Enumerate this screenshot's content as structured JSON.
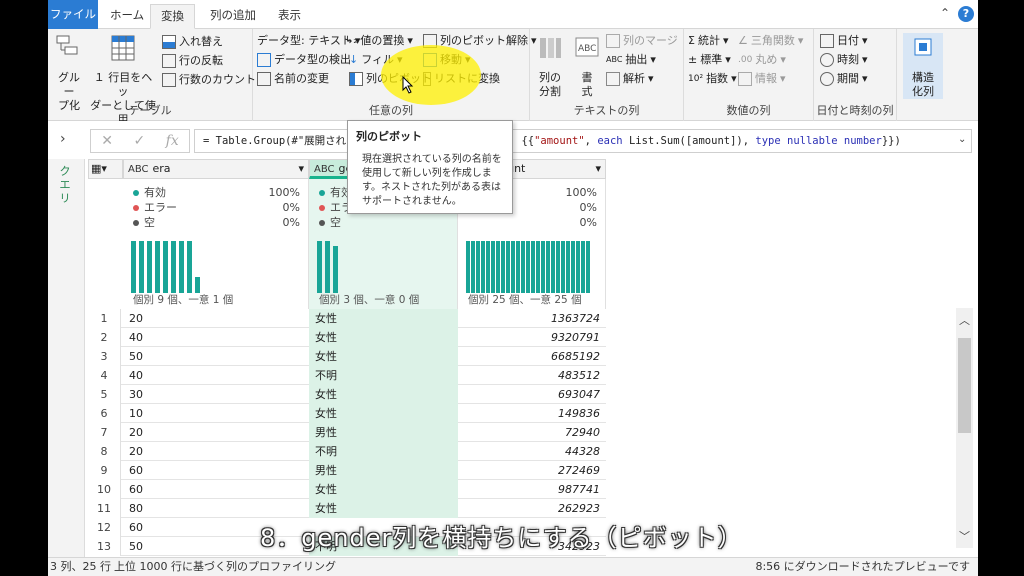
{
  "tabs": {
    "file": "ファイル",
    "home": "ホーム",
    "transform": "変換",
    "add_column": "列の追加",
    "view": "表示"
  },
  "ribbon": {
    "table_group": {
      "label": "テーブル",
      "group_by": "グルー\nプ化",
      "first_row_header": "１ 行目をヘッ\nダーとして使用",
      "transpose": "入れ替え",
      "reverse_rows": "行の反転",
      "count_rows": "行数のカウント"
    },
    "any_column_group": {
      "label": "任意の列",
      "data_type": "データ型: テキスト",
      "detect_type": "データ型の検出",
      "rename": "名前の変更",
      "replace_values": "値の置換",
      "fill": "フィル",
      "pivot_column": "列のピボット",
      "unpivot": "列のピボット解除",
      "move": "移動",
      "convert_to_list": "リストに変換"
    },
    "text_group": {
      "label": "テキストの列",
      "split_column": "列の\n分割",
      "format": "書\n式",
      "merge_columns": "列のマージ",
      "extract": "抽出",
      "parse": "解析"
    },
    "number_group": {
      "label": "数値の列",
      "statistics": "統計",
      "standard": "標準",
      "scientific": "指数",
      "trigonometry": "三角関数",
      "rounding": "丸め",
      "information": "情報"
    },
    "datetime_group": {
      "label": "日付と時刻の列",
      "date": "日付",
      "time": "時刻",
      "duration": "期間"
    },
    "structured_column": "構造\n化列"
  },
  "formula": {
    "prefix": "= Table.Group(#\"展開され",
    "suffix_str": "\"amount\"",
    "suffix_each": "each",
    "suffix_fn": "List.Sum([amount]),",
    "suffix_type": "type nullable number",
    "suffix_tail": "}})"
  },
  "queries_label": "クエリ",
  "columns": [
    {
      "name": "era",
      "type": "ABC",
      "valid": "100%",
      "error": "0%",
      "empty": "0%",
      "foot": "個別 9 個、一意 1 個",
      "bars": [
        100,
        100,
        100,
        100,
        100,
        100,
        100,
        100,
        30
      ]
    },
    {
      "name": "gender",
      "type": "ABC",
      "valid": "100%",
      "error": "0%",
      "empty": "0%",
      "foot": "個別 3 個、一意 0 個",
      "bars": [
        100,
        100,
        90
      ]
    },
    {
      "name": "amount",
      "type": "1.2",
      "valid": "100%",
      "error": "0%",
      "empty": "0%",
      "foot": "個別 25 個、一意 25 個",
      "bars": [
        100,
        100,
        100,
        100,
        100,
        100,
        100,
        100,
        100,
        100,
        100,
        100,
        100,
        100,
        100,
        100,
        100,
        100,
        100,
        100,
        100,
        100,
        100,
        100,
        100
      ]
    }
  ],
  "profile_labels": {
    "valid": "有効",
    "error": "エラー",
    "empty": "空"
  },
  "rows": [
    {
      "n": "1",
      "era": "20",
      "gender": "女性",
      "amount": "1363724"
    },
    {
      "n": "2",
      "era": "40",
      "gender": "女性",
      "amount": "9320791"
    },
    {
      "n": "3",
      "era": "50",
      "gender": "女性",
      "amount": "6685192"
    },
    {
      "n": "4",
      "era": "40",
      "gender": "不明",
      "amount": "483512"
    },
    {
      "n": "5",
      "era": "30",
      "gender": "女性",
      "amount": "693047"
    },
    {
      "n": "6",
      "era": "10",
      "gender": "女性",
      "amount": "149836"
    },
    {
      "n": "7",
      "era": "20",
      "gender": "男性",
      "amount": "72940"
    },
    {
      "n": "8",
      "era": "20",
      "gender": "不明",
      "amount": "44328"
    },
    {
      "n": "9",
      "era": "60",
      "gender": "男性",
      "amount": "272469"
    },
    {
      "n": "10",
      "era": "60",
      "gender": "女性",
      "amount": "987741"
    },
    {
      "n": "11",
      "era": "80",
      "gender": "女性",
      "amount": "262923"
    },
    {
      "n": "12",
      "era": "60",
      "gender": "",
      "amount": ""
    },
    {
      "n": "13",
      "era": "50",
      "gender": "不明",
      "amount": "342923"
    }
  ],
  "tooltip": {
    "title": "列のピボット",
    "body": "現在選択されている列の名前を使用して新しい列を作成します。ネストされた列がある表はサポートされません。"
  },
  "status": {
    "left": "3 列、25 行",
    "profiling": "上位 1000 行に基づく列のプロファイリング",
    "right": "8:56 にダウンロードされたプレビューです"
  },
  "caption": "8．gender列を横持ちにする（ピボット）",
  "colors": {
    "accent": "#2b7cd3",
    "bar": "#19a597",
    "selected_col": "#dcf2e7",
    "valid_dot": "#19a597",
    "error_dot": "#e05555",
    "empty_dot": "#555555"
  }
}
